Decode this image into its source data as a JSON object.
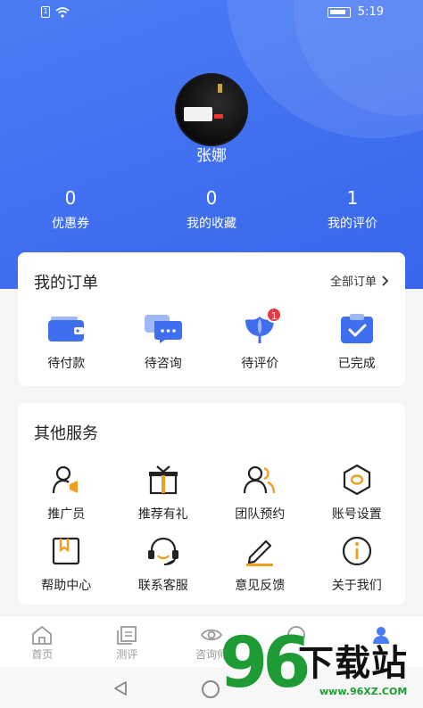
{
  "status_bar": {
    "time": "5:19"
  },
  "profile": {
    "name": "张娜"
  },
  "stats": [
    {
      "value": "0",
      "label": "优惠券"
    },
    {
      "value": "0",
      "label": "我的收藏"
    },
    {
      "value": "1",
      "label": "我的评价"
    }
  ],
  "orders": {
    "title": "我的订单",
    "all_link": "全部订单",
    "items": [
      {
        "label": "待付款",
        "icon": "wallet-icon"
      },
      {
        "label": "待咨询",
        "icon": "chat-icon"
      },
      {
        "label": "待评价",
        "icon": "flower-icon",
        "badge": "1"
      },
      {
        "label": "已完成",
        "icon": "clipboard-check-icon"
      }
    ]
  },
  "services": {
    "title": "其他服务",
    "items": [
      {
        "label": "推广员",
        "icon": "promoter-icon"
      },
      {
        "label": "推荐有礼",
        "icon": "gift-icon"
      },
      {
        "label": "团队预约",
        "icon": "team-icon"
      },
      {
        "label": "账号设置",
        "icon": "hexagon-settings-icon"
      },
      {
        "label": "帮助中心",
        "icon": "bookmark-icon"
      },
      {
        "label": "联系客服",
        "icon": "headset-icon"
      },
      {
        "label": "意见反馈",
        "icon": "pen-icon"
      },
      {
        "label": "关于我们",
        "icon": "info-icon"
      }
    ]
  },
  "tabbar": [
    {
      "label": "首页",
      "icon": "home-icon"
    },
    {
      "label": "测评",
      "icon": "document-icon"
    },
    {
      "label": "咨询师",
      "icon": "eye-icon"
    },
    {
      "label": "",
      "icon": "circle-icon"
    },
    {
      "label": "",
      "icon": "profile-icon"
    }
  ],
  "watermark": {
    "brand_number": "96",
    "brand_text": "下载站",
    "url": "www.96XZ.COM"
  },
  "colors": {
    "primary": "#4a7df5",
    "accent_orange": "#f0a020",
    "badge_red": "#e63946",
    "watermark_green": "#1e9b34"
  }
}
